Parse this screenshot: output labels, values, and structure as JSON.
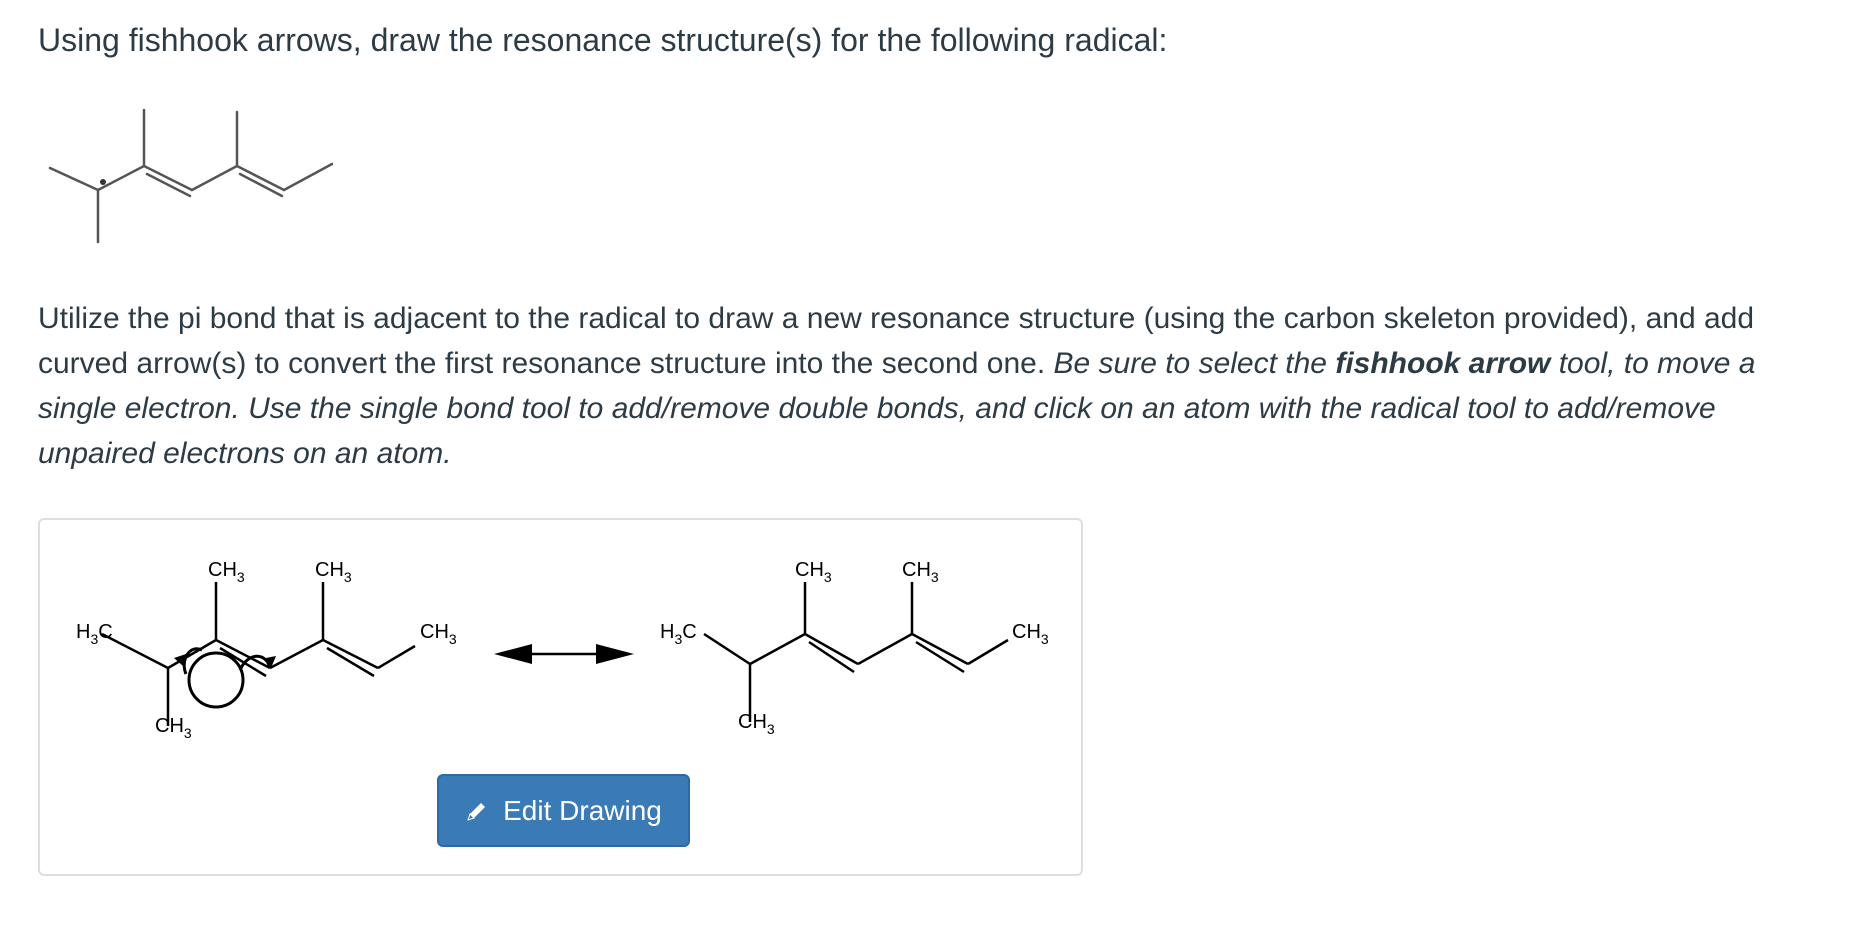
{
  "question": {
    "prompt": "Using fishhook arrows, draw the resonance structure(s) for the following radical:"
  },
  "instructions": {
    "part1": "Utilize the pi bond that is adjacent to the radical to draw a new resonance structure (using the carbon skeleton provided), and add curved arrow(s) to convert the first resonance structure into the second one. ",
    "part2_italic": "Be sure to select the ",
    "bold_italic": "fishhook arrow",
    "part3_italic": " tool, to move a single electron. Use the single bond tool to add/remove double bonds, and click on an atom with the radical tool to add/remove unpaired electrons on an atom."
  },
  "drawing": {
    "edit_button_label": "Edit Drawing",
    "edit_button_icon": "pencil-icon",
    "left_structure": {
      "labels": [
        "CH",
        "3",
        "CH",
        "3",
        "H",
        "3",
        "C",
        "CH",
        "3",
        "CH",
        "3"
      ]
    },
    "right_structure": {
      "labels": [
        "CH",
        "3",
        "CH",
        "3",
        "H",
        "3",
        "C",
        "CH",
        "3",
        "CH",
        "3"
      ]
    },
    "arrow_type": "resonance-double-headed"
  }
}
